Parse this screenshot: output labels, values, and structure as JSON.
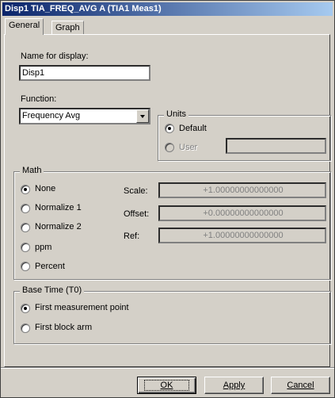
{
  "window": {
    "title": "Disp1 TIA_FREQ_AVG A (TIA1 Meas1)"
  },
  "tabs": [
    {
      "label": "General",
      "active": true
    },
    {
      "label": "Graph",
      "active": false
    }
  ],
  "general": {
    "name_label": "Name for display:",
    "name_value": "Disp1",
    "function_label": "Function:",
    "function_value": "Frequency Avg",
    "units": {
      "legend": "Units",
      "default_label": "Default",
      "user_label": "User",
      "user_value": "",
      "selected": "Default"
    },
    "math": {
      "legend": "Math",
      "options": [
        "None",
        "Normalize 1",
        "Normalize 2",
        "ppm",
        "Percent"
      ],
      "selected": "None",
      "scale_label": "Scale:",
      "scale_value": "+1.00000000000000",
      "offset_label": "Offset:",
      "offset_value": "+0.00000000000000",
      "ref_label": "Ref:",
      "ref_value": "+1.00000000000000"
    },
    "base_time": {
      "legend": "Base Time (T0)",
      "options": [
        "First measurement point",
        "First block arm"
      ],
      "selected": "First measurement point"
    }
  },
  "buttons": {
    "ok": "OK",
    "apply": "Apply",
    "cancel": "Cancel"
  }
}
